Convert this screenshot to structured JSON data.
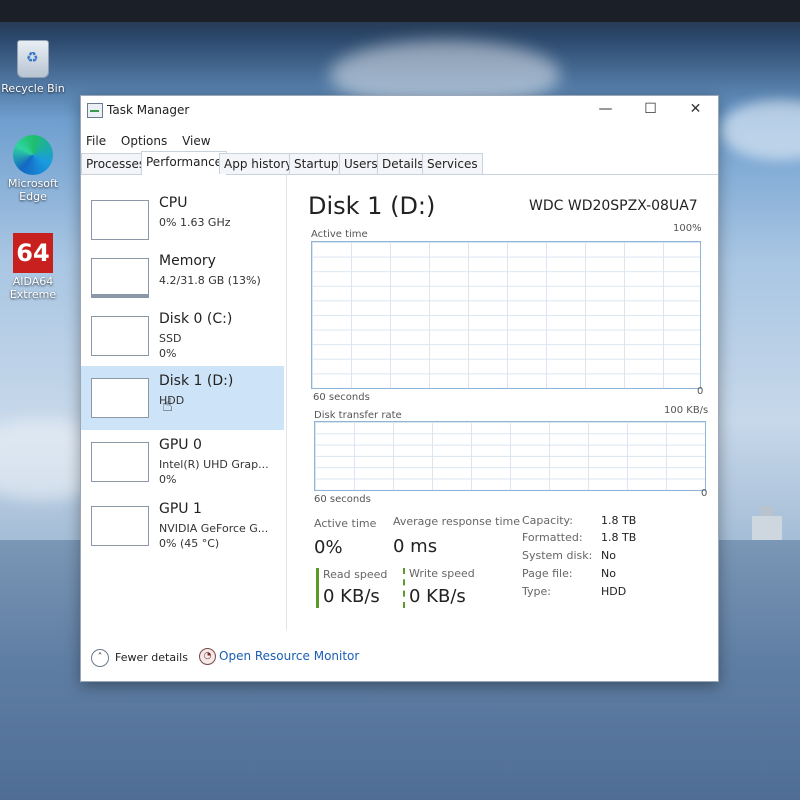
{
  "desktop": {
    "icons": [
      {
        "label": "Recycle Bin",
        "icon": "recycle-bin-icon"
      },
      {
        "label": "Microsoft Edge",
        "icon": "edge-icon"
      },
      {
        "label": "AIDA64 Extreme",
        "icon": "aida64-icon",
        "logo_text": "64"
      }
    ]
  },
  "window": {
    "title": "Task Manager",
    "controls": {
      "minimize": "—",
      "maximize": "☐",
      "close": "✕"
    },
    "menu": [
      "File",
      "Options",
      "View"
    ],
    "tabs": [
      "Processes",
      "Performance",
      "App history",
      "Startup",
      "Users",
      "Details",
      "Services"
    ],
    "active_tab": "Performance"
  },
  "resources": [
    {
      "name": "CPU",
      "sub1": "0% 1.63 GHz",
      "sub2": ""
    },
    {
      "name": "Memory",
      "sub1": "4.2/31.8 GB (13%)",
      "sub2": ""
    },
    {
      "name": "Disk 0 (C:)",
      "sub1": "SSD",
      "sub2": "0%"
    },
    {
      "name": "Disk 1 (D:)",
      "sub1": "HDD",
      "sub2": "",
      "selected": true
    },
    {
      "name": "GPU 0",
      "sub1": "Intel(R) UHD Grap...",
      "sub2": "0%"
    },
    {
      "name": "GPU 1",
      "sub1": "NVIDIA GeForce G...",
      "sub2": "0% (45 °C)"
    }
  ],
  "detail": {
    "title": "Disk 1 (D:)",
    "model": "WDC WD20SPZX-08UA7",
    "graph1": {
      "label": "Active time",
      "max": "100%",
      "span": "60 seconds",
      "min": "0"
    },
    "graph2": {
      "label": "Disk transfer rate",
      "max": "100 KB/s",
      "span": "60 seconds",
      "min": "0"
    },
    "stats": {
      "active_time_label": "Active time",
      "active_time_value": "0%",
      "response_label": "Average response time",
      "response_value": "0 ms",
      "read_label": "Read speed",
      "read_value": "0 KB/s",
      "write_label": "Write speed",
      "write_value": "0 KB/s"
    },
    "properties": [
      {
        "key": "Capacity:",
        "value": "1.8 TB"
      },
      {
        "key": "Formatted:",
        "value": "1.8 TB"
      },
      {
        "key": "System disk:",
        "value": "No"
      },
      {
        "key": "Page file:",
        "value": "No"
      },
      {
        "key": "Type:",
        "value": "HDD"
      }
    ],
    "colors": {
      "read": "#5a9a2b",
      "write": "#5a9a2b",
      "graph_border": "#8fb4d6",
      "selection": "#cde3f7"
    }
  },
  "footer": {
    "fewer_details": "Fewer details",
    "open_resource_monitor": "Open Resource Monitor"
  }
}
